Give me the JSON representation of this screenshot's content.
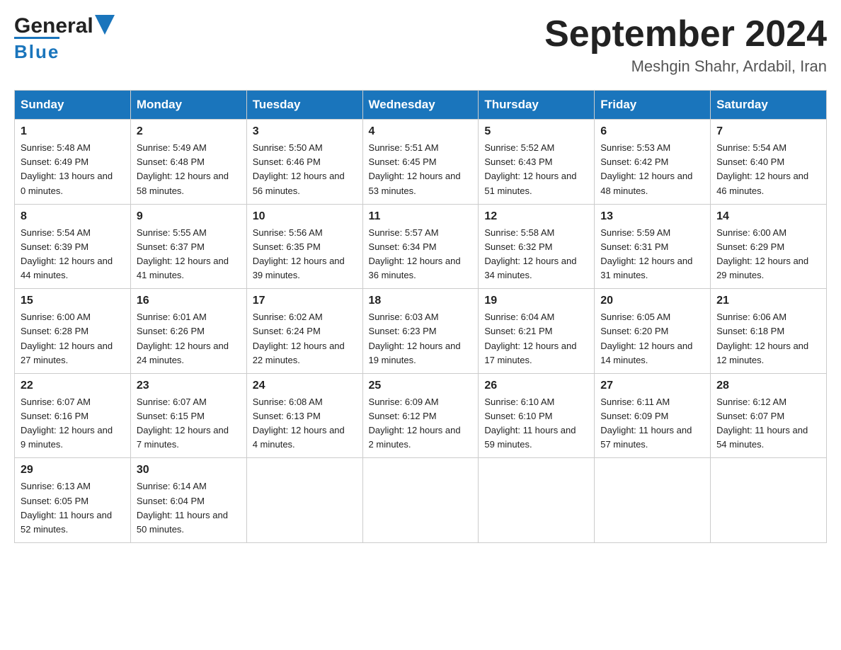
{
  "logo": {
    "general": "General",
    "blue": "Blue"
  },
  "title": "September 2024",
  "subtitle": "Meshgin Shahr, Ardabil, Iran",
  "days_of_week": [
    "Sunday",
    "Monday",
    "Tuesday",
    "Wednesday",
    "Thursday",
    "Friday",
    "Saturday"
  ],
  "weeks": [
    [
      {
        "day": "1",
        "sunrise": "5:48 AM",
        "sunset": "6:49 PM",
        "daylight": "13 hours and 0 minutes."
      },
      {
        "day": "2",
        "sunrise": "5:49 AM",
        "sunset": "6:48 PM",
        "daylight": "12 hours and 58 minutes."
      },
      {
        "day": "3",
        "sunrise": "5:50 AM",
        "sunset": "6:46 PM",
        "daylight": "12 hours and 56 minutes."
      },
      {
        "day": "4",
        "sunrise": "5:51 AM",
        "sunset": "6:45 PM",
        "daylight": "12 hours and 53 minutes."
      },
      {
        "day": "5",
        "sunrise": "5:52 AM",
        "sunset": "6:43 PM",
        "daylight": "12 hours and 51 minutes."
      },
      {
        "day": "6",
        "sunrise": "5:53 AM",
        "sunset": "6:42 PM",
        "daylight": "12 hours and 48 minutes."
      },
      {
        "day": "7",
        "sunrise": "5:54 AM",
        "sunset": "6:40 PM",
        "daylight": "12 hours and 46 minutes."
      }
    ],
    [
      {
        "day": "8",
        "sunrise": "5:54 AM",
        "sunset": "6:39 PM",
        "daylight": "12 hours and 44 minutes."
      },
      {
        "day": "9",
        "sunrise": "5:55 AM",
        "sunset": "6:37 PM",
        "daylight": "12 hours and 41 minutes."
      },
      {
        "day": "10",
        "sunrise": "5:56 AM",
        "sunset": "6:35 PM",
        "daylight": "12 hours and 39 minutes."
      },
      {
        "day": "11",
        "sunrise": "5:57 AM",
        "sunset": "6:34 PM",
        "daylight": "12 hours and 36 minutes."
      },
      {
        "day": "12",
        "sunrise": "5:58 AM",
        "sunset": "6:32 PM",
        "daylight": "12 hours and 34 minutes."
      },
      {
        "day": "13",
        "sunrise": "5:59 AM",
        "sunset": "6:31 PM",
        "daylight": "12 hours and 31 minutes."
      },
      {
        "day": "14",
        "sunrise": "6:00 AM",
        "sunset": "6:29 PM",
        "daylight": "12 hours and 29 minutes."
      }
    ],
    [
      {
        "day": "15",
        "sunrise": "6:00 AM",
        "sunset": "6:28 PM",
        "daylight": "12 hours and 27 minutes."
      },
      {
        "day": "16",
        "sunrise": "6:01 AM",
        "sunset": "6:26 PM",
        "daylight": "12 hours and 24 minutes."
      },
      {
        "day": "17",
        "sunrise": "6:02 AM",
        "sunset": "6:24 PM",
        "daylight": "12 hours and 22 minutes."
      },
      {
        "day": "18",
        "sunrise": "6:03 AM",
        "sunset": "6:23 PM",
        "daylight": "12 hours and 19 minutes."
      },
      {
        "day": "19",
        "sunrise": "6:04 AM",
        "sunset": "6:21 PM",
        "daylight": "12 hours and 17 minutes."
      },
      {
        "day": "20",
        "sunrise": "6:05 AM",
        "sunset": "6:20 PM",
        "daylight": "12 hours and 14 minutes."
      },
      {
        "day": "21",
        "sunrise": "6:06 AM",
        "sunset": "6:18 PM",
        "daylight": "12 hours and 12 minutes."
      }
    ],
    [
      {
        "day": "22",
        "sunrise": "6:07 AM",
        "sunset": "6:16 PM",
        "daylight": "12 hours and 9 minutes."
      },
      {
        "day": "23",
        "sunrise": "6:07 AM",
        "sunset": "6:15 PM",
        "daylight": "12 hours and 7 minutes."
      },
      {
        "day": "24",
        "sunrise": "6:08 AM",
        "sunset": "6:13 PM",
        "daylight": "12 hours and 4 minutes."
      },
      {
        "day": "25",
        "sunrise": "6:09 AM",
        "sunset": "6:12 PM",
        "daylight": "12 hours and 2 minutes."
      },
      {
        "day": "26",
        "sunrise": "6:10 AM",
        "sunset": "6:10 PM",
        "daylight": "11 hours and 59 minutes."
      },
      {
        "day": "27",
        "sunrise": "6:11 AM",
        "sunset": "6:09 PM",
        "daylight": "11 hours and 57 minutes."
      },
      {
        "day": "28",
        "sunrise": "6:12 AM",
        "sunset": "6:07 PM",
        "daylight": "11 hours and 54 minutes."
      }
    ],
    [
      {
        "day": "29",
        "sunrise": "6:13 AM",
        "sunset": "6:05 PM",
        "daylight": "11 hours and 52 minutes."
      },
      {
        "day": "30",
        "sunrise": "6:14 AM",
        "sunset": "6:04 PM",
        "daylight": "11 hours and 50 minutes."
      },
      null,
      null,
      null,
      null,
      null
    ]
  ]
}
